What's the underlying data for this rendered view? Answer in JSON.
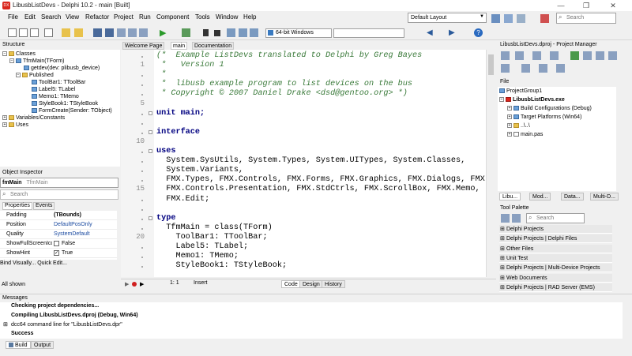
{
  "window": {
    "title": "LibusbListDevs - Delphi 10.2 - main [Built]",
    "logo_text": "DX",
    "minimize": "—",
    "maximize": "❐",
    "close": "✕"
  },
  "menu": [
    "File",
    "Edit",
    "Search",
    "View",
    "Refactor",
    "Project",
    "Run",
    "Component",
    "Tools",
    "Window",
    "Help"
  ],
  "layout_select": "Default Layout",
  "search": {
    "placeholder": "Search"
  },
  "toolbar": {
    "platform": "64-bit Windows"
  },
  "structure": {
    "title": "Structure",
    "items": [
      "Classes",
      "TfmMain(TForm)",
      "getdev(dev: plibusb_device)",
      "Published",
      "ToolBar1: TToolBar",
      "Label5: TLabel",
      "Memo1: TMemo",
      "StyleBook1: TStyleBook",
      "FormCreate(Sender: TObject)",
      "Variables/Constants",
      "Uses"
    ]
  },
  "object_inspector": {
    "title": "Object Inspector",
    "object_name": "fmMain",
    "object_type": "TfmMain",
    "search_placeholder": "Search",
    "tab_properties": "Properties",
    "tab_events": "Events",
    "rows": [
      {
        "name": "Padding",
        "value": "(TBounds)"
      },
      {
        "name": "Position",
        "value": "DefaultPosOnly"
      },
      {
        "name": "Quality",
        "value": "SystemDefault"
      },
      {
        "name": "ShowFullScreenIcon",
        "value": "False"
      },
      {
        "name": "ShowHint",
        "value": "True"
      }
    ],
    "footer_links": "Bind Visually...  Quick Edit...",
    "footer_filter": "All shown"
  },
  "editor": {
    "tabs": [
      "Welcome Page",
      "main",
      "Documentation"
    ],
    "line_numbers": [
      {
        "n": "1",
        "line": 2
      },
      {
        "n": "5",
        "line": 6
      },
      {
        "n": "10",
        "line": 10
      },
      {
        "n": "15",
        "line": 15
      },
      {
        "n": "20",
        "line": 20
      }
    ],
    "lines": [
      "(*  Example ListDevs translated to Delphi by Greg Bayes",
      " *   Version 1",
      " *",
      " *  libusb example program to list devices on the bus",
      " * Copyright © 2007 Daniel Drake <dsd@gentoo.org> *)",
      "",
      "unit main;",
      "",
      "interface",
      "",
      "uses",
      "  System.SysUtils, System.Types, System.UITypes, System.Classes,",
      "  System.Variants,",
      "  FMX.Types, FMX.Controls, FMX.Forms, FMX.Graphics, FMX.Dialogs, FMX",
      "  FMX.Controls.Presentation, FMX.StdCtrls, FMX.ScrollBox, FMX.Memo,",
      "  FMX.Edit;",
      "",
      "type",
      "  TfmMain = class(TForm)",
      "    ToolBar1: TToolBar;",
      "    Label5: TLabel;",
      "    Memo1: TMemo;",
      "    StyleBook1: TStyleBook;"
    ],
    "status": {
      "position": "1:  1",
      "mode": "Insert",
      "tabs": [
        "Code",
        "Design",
        "History"
      ]
    }
  },
  "project_manager": {
    "title": "LibusbListDevs.dproj - Project Manager",
    "file_label": "File",
    "items": [
      "ProjectGroup1",
      "LibusbListDevs.exe",
      "Build Configurations (Debug)",
      "Target Platforms (Win64)",
      "..\\..\\",
      "main.pas"
    ],
    "bottom_tabs": [
      "Libu...",
      "Mod...",
      "Data...",
      "Multi-D..."
    ]
  },
  "tool_palette": {
    "title": "Tool Palette",
    "search_placeholder": "Search",
    "categories": [
      "Delphi Projects",
      "Delphi Projects | Delphi Files",
      "Other Files",
      "Unit Test",
      "Delphi Projects | Multi-Device Projects",
      "Web Documents",
      "Delphi Projects | RAD Server (EMS)"
    ]
  },
  "messages": {
    "title": "Messages",
    "lines": [
      "Checking project dependencies...",
      "Compiling LibusbListDevs.dproj (Debug, Win64)",
      "dcc64 command line for \"LibusbListDevs.dpr\"",
      "Success"
    ],
    "tabs": [
      "Build",
      "Output"
    ]
  },
  "colors": {
    "accent": "#d9261c",
    "comment": "#3a7a3a",
    "keyword": "#000080"
  }
}
